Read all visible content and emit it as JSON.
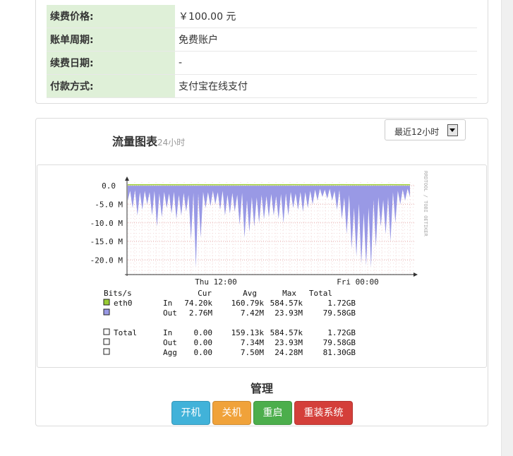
{
  "info": {
    "rows": [
      {
        "label": "续费价格:",
        "value": "￥100.00 元"
      },
      {
        "label": "账单周期:",
        "value": "免费账户"
      },
      {
        "label": "续费日期:",
        "value": "-"
      },
      {
        "label": "付款方式:",
        "value": "支付宝在线支付"
      }
    ]
  },
  "chart": {
    "title": "流量图表",
    "subtitle": "24小时",
    "range_selected": "最近12小时",
    "watermark": "RRDTOOL / TOBI OETIKER"
  },
  "chart_data": {
    "type": "area",
    "ylabel": "Bits/s",
    "y_ticks": [
      "0.0",
      "-5.0 M",
      "-10.0 M",
      "-15.0 M",
      "-20.0 M"
    ],
    "y_tick_values": [
      0,
      -5,
      -10,
      -15,
      -20
    ],
    "x_ticks": [
      "Thu 12:00",
      "Fri 00:00"
    ],
    "ylim": [
      -23.9,
      0.2
    ],
    "series": [
      {
        "name": "In",
        "color": "#99cc33",
        "values_mbps": [
          0.07,
          0.07,
          0.07,
          0.08,
          0.07,
          0.07,
          0.07,
          0.08,
          0.07,
          0.07,
          0.07,
          0.07,
          0.08,
          0.07,
          0.07,
          0.07,
          0.07,
          0.08,
          0.07,
          0.07,
          0.07,
          0.07,
          0.08,
          0.07,
          0.07,
          0.07,
          0.07,
          0.08,
          0.07,
          0.07
        ]
      },
      {
        "name": "Out",
        "color": "#9999e5",
        "values_mbps": [
          -4,
          -8,
          -5,
          -11,
          -6,
          -9,
          -7,
          -22,
          -6,
          -5,
          -8,
          -7,
          -14,
          -11,
          -9,
          -8,
          -10,
          -6,
          -7,
          -5,
          -3,
          -4,
          -9,
          -17,
          -21,
          -22,
          -11,
          -15,
          -5,
          -3
        ]
      }
    ],
    "legend": {
      "headers": [
        "Bits/s",
        "Cur",
        "Avg",
        "Max",
        "Total"
      ],
      "rows": [
        {
          "name": "eth0",
          "dir": "In",
          "cur": "74.20k",
          "avg": "160.79k",
          "max": "584.57k",
          "total": "1.72GB",
          "color": "#99cc33"
        },
        {
          "name": "",
          "dir": "Out",
          "cur": "2.76M",
          "avg": "7.42M",
          "max": "23.93M",
          "total": "79.58GB",
          "color": "#9999e5"
        },
        {
          "name": "Total",
          "dir": "In",
          "cur": "0.00",
          "avg": "159.13k",
          "max": "584.57k",
          "total": "1.72GB",
          "color": "#ffffff"
        },
        {
          "name": "",
          "dir": "Out",
          "cur": "0.00",
          "avg": "7.34M",
          "max": "23.93M",
          "total": "79.58GB",
          "color": "#ffffff"
        },
        {
          "name": "",
          "dir": "Agg",
          "cur": "0.00",
          "avg": "7.50M",
          "max": "24.28M",
          "total": "81.30GB",
          "color": "#ffffff"
        }
      ]
    }
  },
  "manage": {
    "title": "管理",
    "buttons": {
      "start": "开机",
      "stop": "关机",
      "restart": "重启",
      "reinstall": "重装系统"
    }
  }
}
